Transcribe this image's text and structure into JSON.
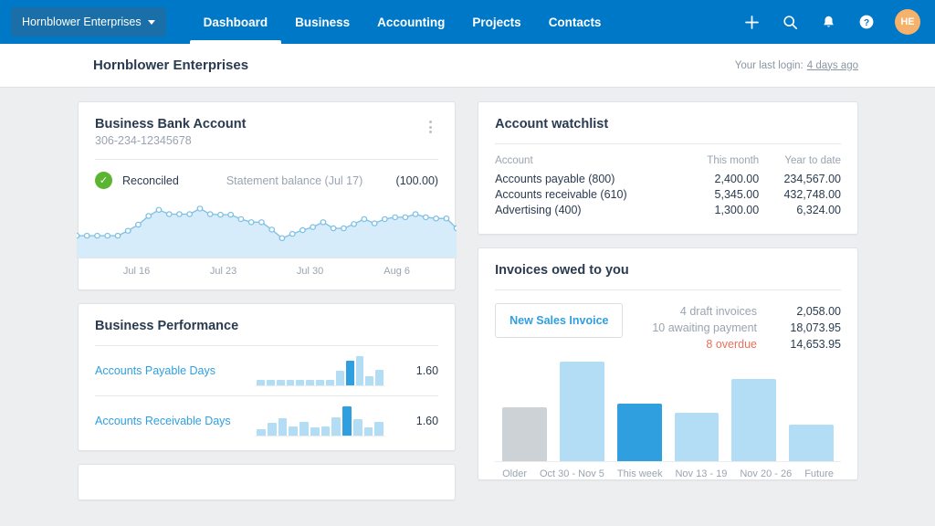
{
  "topnav": {
    "org_name": "Hornblower Enterprises",
    "links": [
      {
        "label": "Dashboard",
        "active": true
      },
      {
        "label": "Business",
        "active": false
      },
      {
        "label": "Accounting",
        "active": false
      },
      {
        "label": "Projects",
        "active": false
      },
      {
        "label": "Contacts",
        "active": false
      }
    ],
    "icons": [
      "plus-icon",
      "search-icon",
      "bell-icon",
      "help-icon"
    ],
    "avatar_initials": "HE",
    "avatar_color": "#f6b26b",
    "background_color": "#0078c8"
  },
  "subheader": {
    "page_title": "Hornblower Enterprises",
    "last_login_label": "Your last login:",
    "last_login_value": "4 days ago"
  },
  "bank_card": {
    "title": "Business Bank Account",
    "account_number": "306-234-12345678",
    "status": "Reconciled",
    "statement_label": "Statement balance (Jul 17)",
    "statement_amount": "(100.00)",
    "menu_icon": "kebab-menu-icon"
  },
  "performance_card": {
    "title": "Business Performance",
    "rows": [
      {
        "label": "Accounts Payable Days",
        "value": "1.60"
      },
      {
        "label": "Accounts Receivable Days",
        "value": "1.60"
      }
    ]
  },
  "watchlist_card": {
    "title": "Account watchlist",
    "columns": [
      "Account",
      "This month",
      "Year to date"
    ],
    "rows": [
      {
        "account": "Accounts payable (800)",
        "this_month": "2,400.00",
        "ytd": "234,567.00"
      },
      {
        "account": "Accounts receivable (610)",
        "this_month": "5,345.00",
        "ytd": "432,748.00"
      },
      {
        "account": "Advertising (400)",
        "this_month": "1,300.00",
        "ytd": "6,324.00"
      }
    ]
  },
  "invoices_card": {
    "title": "Invoices owed to you",
    "new_invoice_button": "New Sales Invoice",
    "stats": [
      {
        "label": "4 draft invoices",
        "amount": "2,058.00",
        "overdue": false
      },
      {
        "label": "10 awaiting payment",
        "amount": "18,073.95",
        "overdue": false
      },
      {
        "label": "8 overdue",
        "amount": "14,653.95",
        "overdue": true
      }
    ]
  },
  "chart_data": [
    {
      "type": "area",
      "name": "bank-account-balance-sparkline",
      "title": "Business Bank Account balance",
      "xlabel": "",
      "ylabel": "",
      "grid": false,
      "legend": "none",
      "tick_labels": [
        "Jul 16",
        "Jul 23",
        "Jul 30",
        "Aug 6"
      ],
      "x": [
        0,
        1,
        2,
        3,
        4,
        5,
        6,
        7,
        8,
        9,
        10,
        11,
        12,
        13,
        14,
        15,
        16,
        17,
        18,
        19,
        20,
        21,
        22,
        23,
        24,
        25,
        26,
        27,
        28,
        29,
        30,
        31,
        32,
        33,
        34,
        35,
        36,
        37
      ],
      "values": [
        28,
        28,
        28,
        28,
        28,
        36,
        46,
        60,
        70,
        63,
        63,
        63,
        72,
        63,
        62,
        62,
        55,
        50,
        50,
        38,
        24,
        31,
        37,
        42,
        50,
        40,
        40,
        47,
        55,
        48,
        55,
        58,
        58,
        63,
        58,
        56,
        56,
        40
      ]
    },
    {
      "type": "bar",
      "name": "accounts-payable-days-sparkline",
      "title": "Accounts Payable Days",
      "categories": [
        "1",
        "2",
        "3",
        "4",
        "5",
        "6",
        "7",
        "8",
        "9",
        "10",
        "11",
        "12"
      ],
      "values": [
        5,
        5,
        5,
        5,
        5,
        5,
        5,
        5,
        13,
        22,
        26,
        8,
        14
      ],
      "highlight_index": 9,
      "value_label": "1.60"
    },
    {
      "type": "bar",
      "name": "accounts-receivable-days-sparkline",
      "title": "Accounts Receivable Days",
      "categories": [
        "1",
        "2",
        "3",
        "4",
        "5",
        "6",
        "7",
        "8",
        "9",
        "10",
        "11",
        "12"
      ],
      "values": [
        5,
        11,
        15,
        8,
        12,
        7,
        8,
        16,
        26,
        14,
        7,
        12
      ],
      "highlight_index": 8,
      "value_label": "1.60"
    },
    {
      "type": "bar",
      "name": "invoices-owed-bar-chart",
      "title": "Invoices owed to you",
      "categories": [
        "Older",
        "Oct 30 - Nov 5",
        "This week",
        "Nov 13 - 19",
        "Nov 20 - 26",
        "Future"
      ],
      "values": [
        61,
        113,
        65,
        55,
        93,
        42
      ],
      "colors": [
        "#cdd2d7",
        "#b3ddf5",
        "#2f9fe0",
        "#b3ddf5",
        "#b3ddf5",
        "#b3ddf5"
      ],
      "ylabel": "",
      "xlabel": "",
      "grid": false,
      "legend": "none"
    }
  ]
}
